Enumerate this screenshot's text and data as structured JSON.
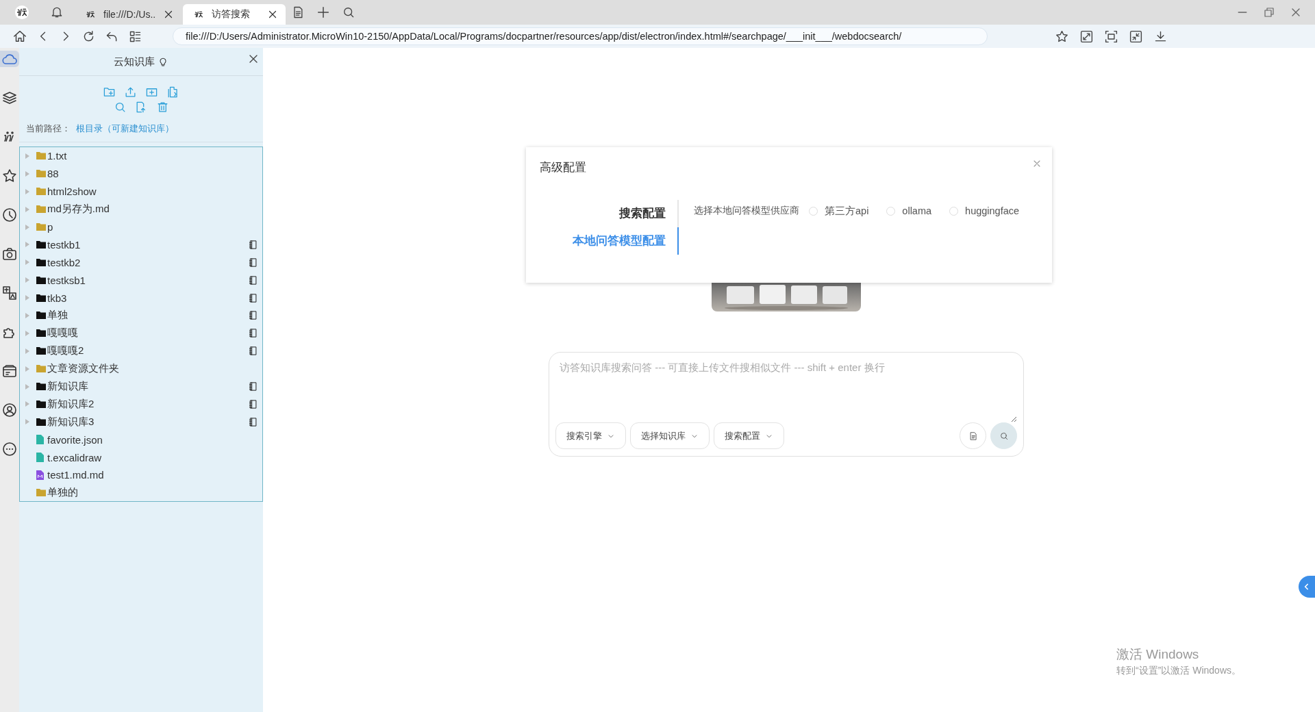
{
  "browser": {
    "tabs": [
      {
        "title": "file:///D:/Us..",
        "selected": false
      },
      {
        "title": "访答搜索",
        "selected": true
      }
    ],
    "url": "file:///D:/Users/Administrator.MicroWin10-2150/AppData/Local/Programs/docpartner/resources/app/dist/electron/index.html#/searchpage/___init___/webdocsearch/"
  },
  "rail": {
    "items": [
      {
        "kind": "cloud",
        "selected": true
      },
      {
        "kind": "layers",
        "selected": false
      },
      {
        "kind": "script",
        "selected": false
      },
      {
        "kind": "star",
        "selected": false
      },
      {
        "kind": "clock",
        "selected": false
      },
      {
        "kind": "camera",
        "selected": false
      },
      {
        "kind": "translate",
        "selected": false
      },
      {
        "kind": "puzzle",
        "selected": false
      },
      {
        "kind": "wallet",
        "selected": false
      },
      {
        "kind": "user",
        "selected": false
      },
      {
        "kind": "more",
        "selected": false
      }
    ]
  },
  "sidebar": {
    "title": "云知识库",
    "path_label": "当前路径：",
    "path_value": "根目录（可新建知识库）",
    "tree": [
      {
        "name": "1.txt",
        "kind": "folder",
        "expandable": true
      },
      {
        "name": "88",
        "kind": "folder",
        "expandable": true
      },
      {
        "name": "html2show",
        "kind": "folder",
        "expandable": true
      },
      {
        "name": "md另存为.md",
        "kind": "folder",
        "expandable": true
      },
      {
        "name": "p",
        "kind": "folder",
        "expandable": true
      },
      {
        "name": "testkb1",
        "kind": "kb",
        "expandable": true
      },
      {
        "name": "testkb2",
        "kind": "kb",
        "expandable": true
      },
      {
        "name": "testksb1",
        "kind": "kb",
        "expandable": true
      },
      {
        "name": "tkb3",
        "kind": "kb",
        "expandable": true
      },
      {
        "name": "单独",
        "kind": "kb",
        "expandable": true
      },
      {
        "name": "嘎嘎嘎",
        "kind": "kb",
        "expandable": true
      },
      {
        "name": "嘎嘎嘎2",
        "kind": "kb",
        "expandable": true
      },
      {
        "name": "文章资源文件夹",
        "kind": "folder",
        "expandable": true
      },
      {
        "name": "新知识库",
        "kind": "kb",
        "expandable": true
      },
      {
        "name": "新知识库2",
        "kind": "kb",
        "expandable": true
      },
      {
        "name": "新知识库3",
        "kind": "kb",
        "expandable": true
      },
      {
        "name": "favorite.json",
        "kind": "file",
        "expandable": false
      },
      {
        "name": "t.excalidraw",
        "kind": "file",
        "expandable": false
      },
      {
        "name": "test1.md.md",
        "kind": "markdown",
        "expandable": false
      },
      {
        "name": "单独的",
        "kind": "folder",
        "expandable": false
      }
    ]
  },
  "dialog": {
    "title": "高级配置",
    "tabs": [
      {
        "label": "搜索配置",
        "selected": false
      },
      {
        "label": "本地问答模型配置",
        "selected": true
      }
    ],
    "field_label": "选择本地问答模型供应商",
    "options": [
      {
        "label": "第三方api",
        "selected": false
      },
      {
        "label": "ollama",
        "selected": false
      },
      {
        "label": "huggingface",
        "selected": false
      }
    ]
  },
  "search": {
    "placeholder": "访答知识库搜索问答 --- 可直接上传文件搜相似文件 --- shift + enter 换行",
    "dropdowns": [
      "搜索引擎",
      "选择知识库",
      "搜索配置"
    ]
  },
  "activation_notice": {
    "title": "激活 Windows",
    "text": "转到“设置”以激活 Windows。"
  }
}
